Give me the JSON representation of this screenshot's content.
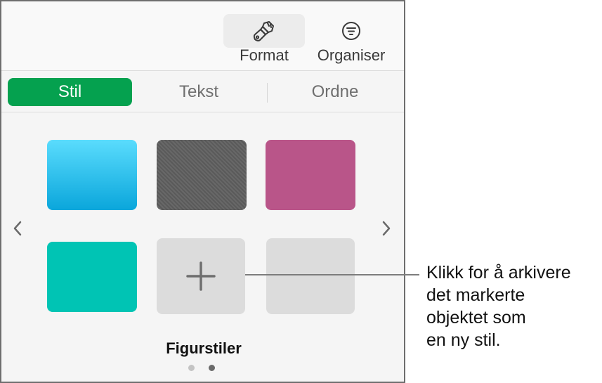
{
  "toolbar": {
    "buttons": [
      {
        "label": "Format",
        "icon": "paintbrush-icon",
        "active": true
      },
      {
        "label": "Organiser",
        "icon": "filter-list-icon",
        "active": false
      }
    ]
  },
  "tabs": [
    {
      "label": "Stil",
      "active": true
    },
    {
      "label": "Tekst",
      "active": false
    },
    {
      "label": "Ordne",
      "active": false
    }
  ],
  "accent_color": "#05a14f",
  "styles": {
    "title": "Figurstiler",
    "swatches": [
      {
        "name": "blue-gradient",
        "color": "#2ec3ef"
      },
      {
        "name": "dark-gray-texture",
        "color": "#5f5f5f"
      },
      {
        "name": "magenta-texture",
        "color": "#b95589"
      },
      {
        "name": "teal",
        "color": "#00c4b4"
      },
      {
        "name": "add-style",
        "color": "#dcdcdc"
      },
      {
        "name": "empty",
        "color": "#dcdcdc"
      }
    ],
    "pages": {
      "current": 2,
      "total": 2
    }
  },
  "callout": {
    "lines": [
      "Klikk for å arkivere",
      "det markerte",
      "objektet som",
      "en ny stil."
    ]
  }
}
